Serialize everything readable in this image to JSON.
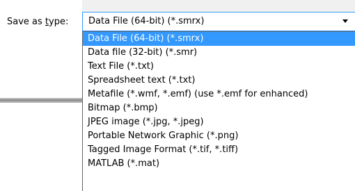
{
  "save_as_type": {
    "label_prefix": "Save as ",
    "label_underlined": "t",
    "label_suffix": "ype:",
    "selected_value": "Data File (64-bit) (*.smrx)",
    "options": [
      "Data File (64-bit) (*.smrx)",
      "Data file (32-bit) (*.smr)",
      "Text File (*.txt)",
      "Spreadsheet text (*.txt)",
      "Metafile (*.wmf, *.emf) (use *.emf for enhanced)",
      "Bitmap (*.bmp)",
      "JPEG image (*.jpg, *.jpeg)",
      "Portable Network Graphic (*.png)",
      "Tagged Image Format (*.tif, *.tiff)",
      "MATLAB (*.mat)"
    ],
    "highlighted_index": 0,
    "colors": {
      "highlight": "#3399ff",
      "highlight_text": "#ffffff"
    }
  }
}
